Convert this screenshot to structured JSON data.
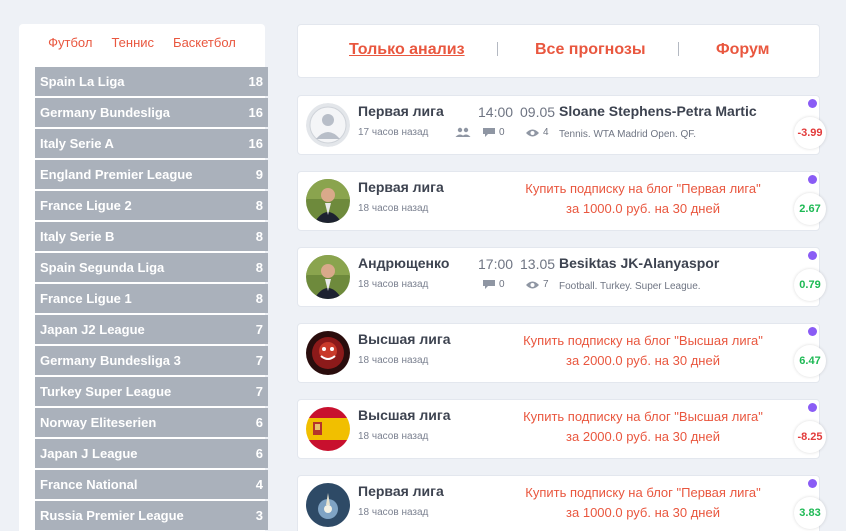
{
  "sport_tabs": [
    "Футбол",
    "Теннис",
    "Баскетбол"
  ],
  "leagues": [
    {
      "name": "Spain La Liga",
      "count": "18"
    },
    {
      "name": "Germany Bundesliga",
      "count": "16"
    },
    {
      "name": "Italy Serie A",
      "count": "16"
    },
    {
      "name": "England Premier League",
      "count": "9"
    },
    {
      "name": "France Ligue 2",
      "count": "8"
    },
    {
      "name": "Italy Serie B",
      "count": "8"
    },
    {
      "name": "Spain Segunda Liga",
      "count": "8"
    },
    {
      "name": "France Ligue 1",
      "count": "8"
    },
    {
      "name": "Japan J2 League",
      "count": "7"
    },
    {
      "name": "Germany Bundesliga 3",
      "count": "7"
    },
    {
      "name": "Turkey Super League",
      "count": "7"
    },
    {
      "name": "Norway Eliteserien",
      "count": "6"
    },
    {
      "name": "Japan J League",
      "count": "6"
    },
    {
      "name": "France National",
      "count": "4"
    },
    {
      "name": "Russia Premier League",
      "count": "3"
    }
  ],
  "nav": {
    "analysis": "Только анализ",
    "all": "Все прогнозы",
    "forum": "Форум"
  },
  "cards": [
    {
      "author": "Первая лига",
      "ago": "17 часов назад",
      "time": "14:00",
      "date": "09.05",
      "match": "Sloane Stephens-Petra Martic",
      "event": "Tennis. WTA Madrid Open. QF.",
      "comments": "0",
      "views": "4",
      "odds": "-3.99"
    },
    {
      "author": "Первая лига",
      "ago": "18 часов назад",
      "promo1": "Купить подписку на блог \"Первая лига\"",
      "promo2": "за 1000.0 руб. на 30 дней",
      "odds": "2.67"
    },
    {
      "author": "Андрющенко",
      "ago": "18 часов назад",
      "time": "17:00",
      "date": "13.05",
      "match": "Besiktas JK-Alanyaspor",
      "event": "Football. Turkey. Super League.",
      "comments": "0",
      "views": "7",
      "odds": "0.79"
    },
    {
      "author": "Высшая лига",
      "ago": "18 часов назад",
      "promo1": "Купить подписку на блог \"Высшая лига\"",
      "promo2": "за 2000.0 руб. на 30 дней",
      "odds": "6.47"
    },
    {
      "author": "Высшая лига",
      "ago": "18 часов назад",
      "promo1": "Купить подписку на блог \"Высшая лига\"",
      "promo2": "за 2000.0 руб. на 30 дней",
      "odds": "-8.25"
    },
    {
      "author": "Первая лига",
      "ago": "18 часов назад",
      "promo1": "Купить подписку на блог \"Первая лига\"",
      "promo2": "за 1000.0 руб. на 30 дней",
      "odds": "3.83"
    }
  ]
}
